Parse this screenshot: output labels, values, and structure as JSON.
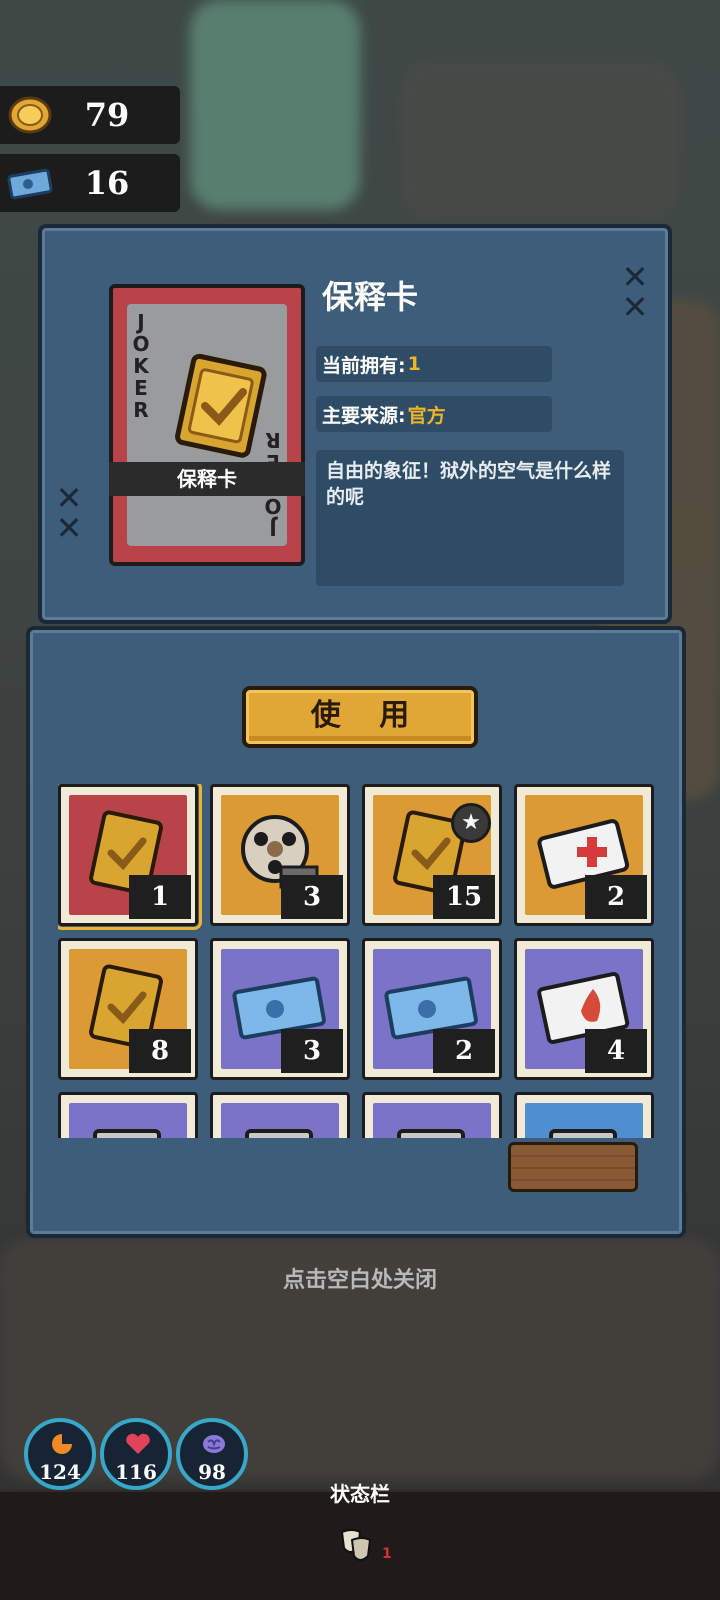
{
  "currency": {
    "coins": {
      "icon": "gold-coin-icon",
      "value": "79"
    },
    "tickets": {
      "icon": "blue-ticket-icon",
      "value": "16"
    }
  },
  "item_detail": {
    "card_label": "保释卡",
    "card_corner_text": "JOKER",
    "title": "保释卡",
    "owned_label": "当前拥有:",
    "owned_value": "1",
    "source_label": "主要来源:",
    "source_value": "官方",
    "description": "自由的象征！狱外的空气是什么样的呢",
    "close_icon": "close-x-icon"
  },
  "actions": {
    "use_label": "使 用"
  },
  "inventory": [
    {
      "name": "bail-card-icon",
      "color": "#b8444a",
      "count": "1",
      "selected": true
    },
    {
      "name": "film-reel-icon",
      "color": "#dc9a34",
      "count": "3"
    },
    {
      "name": "bail-card-star-icon",
      "color": "#dc9a34",
      "count": "15",
      "badge": "star"
    },
    {
      "name": "medical-card-icon",
      "color": "#dc9a34",
      "count": "2"
    },
    {
      "name": "gold-card-icon",
      "color": "#dc9a34",
      "count": "8"
    },
    {
      "name": "toy-ticket-icon",
      "color": "#7a73c8",
      "count": "3"
    },
    {
      "name": "puzzle-ticket-icon",
      "color": "#7a73c8",
      "count": "2"
    },
    {
      "name": "flame-card-icon",
      "color": "#7a73c8",
      "count": "4"
    },
    {
      "name": "bottle-icon",
      "color": "#7a73c8",
      "count": ""
    },
    {
      "name": "cards-icon",
      "color": "#7a73c8",
      "count": ""
    },
    {
      "name": "bread-icon",
      "color": "#7a73c8",
      "count": ""
    },
    {
      "name": "dark-card-icon",
      "color": "#4f8fd0",
      "count": ""
    }
  ],
  "close_hint": "点击空白处关闭",
  "stats": [
    {
      "name": "food-stat",
      "icon": "food-icon",
      "value": "124",
      "color": "#f08a24"
    },
    {
      "name": "health-stat",
      "icon": "heart-icon",
      "value": "116",
      "color": "#e0445a"
    },
    {
      "name": "mind-stat",
      "icon": "brain-icon",
      "value": "98",
      "color": "#8a7ad8"
    }
  ],
  "status_bar": {
    "title": "状态栏",
    "mask_count": "1"
  }
}
